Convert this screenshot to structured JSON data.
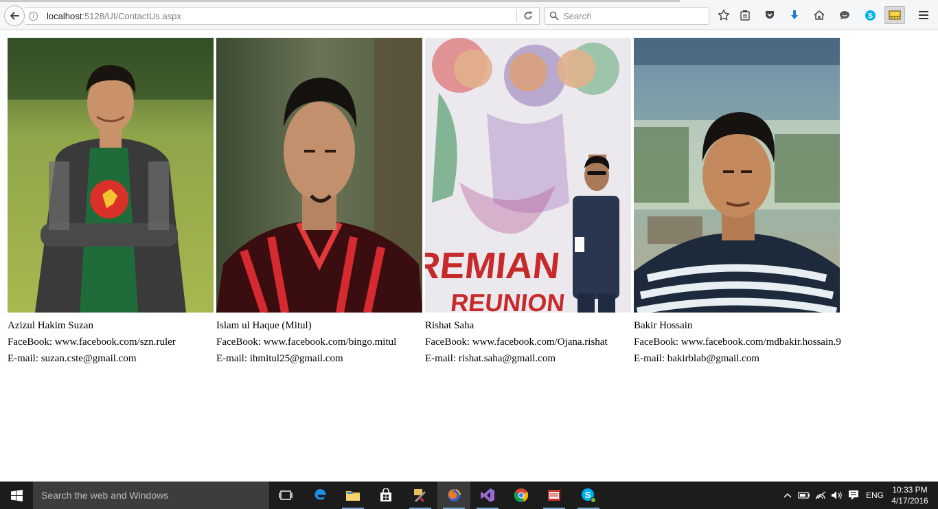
{
  "browser": {
    "url_host": "localhost",
    "url_path": ":5128/UI/ContactUs.aspx",
    "search_placeholder": "Search"
  },
  "contacts": [
    {
      "name": "Azizul Hakim Suzan",
      "facebook": "FaceBook: www.facebook.com/szn.ruler",
      "email": "E-mail: suzan.cste@gmail.com"
    },
    {
      "name": "Islam ul Haque (Mitul)",
      "facebook": "FaceBook: www.facebook.com/bingo.mitul",
      "email": "E-mail: ihmitul25@gmail.com"
    },
    {
      "name": "Rishat Saha",
      "facebook": "FaceBook: www.facebook.com/Ojana.rishat",
      "email": "E-mail: rishat.saha@gmail.com",
      "poster_text_1": "REMIAN",
      "poster_text_2": "REUNION"
    },
    {
      "name": "Bakir Hossain",
      "facebook": "FaceBook: www.facebook.com/mdbakir.hossain.9",
      "email": "E-mail: bakirblab@gmail.com"
    }
  ],
  "taskbar": {
    "search_placeholder": "Search the web and Windows",
    "language": "ENG",
    "time": "10:33 PM",
    "date": "4/17/2016"
  }
}
